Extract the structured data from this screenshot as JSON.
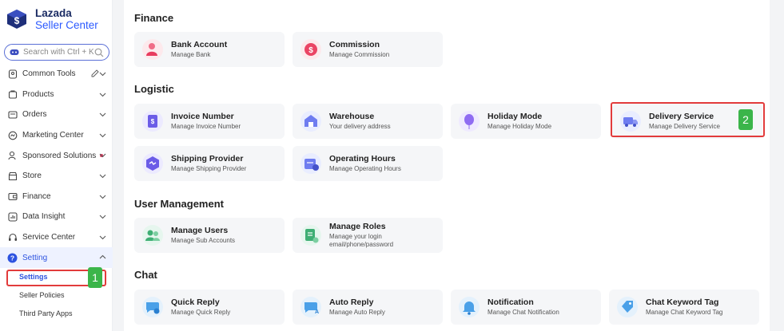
{
  "brand": {
    "line1": "Lazada",
    "line2": "Seller Center"
  },
  "search": {
    "placeholder": "Search with Ctrl + K"
  },
  "nav": [
    {
      "label": "Common Tools",
      "icon": "pin-icon"
    },
    {
      "label": "Products",
      "icon": "bag-icon"
    },
    {
      "label": "Orders",
      "icon": "orders-icon"
    },
    {
      "label": "Marketing Center",
      "icon": "marketing-icon"
    },
    {
      "label": "Sponsored Solutions",
      "icon": "sponsored-icon"
    },
    {
      "label": "Store",
      "icon": "store-icon"
    },
    {
      "label": "Finance",
      "icon": "wallet-icon"
    },
    {
      "label": "Data Insight",
      "icon": "chart-icon"
    },
    {
      "label": "Service Center",
      "icon": "headset-icon"
    },
    {
      "label": "Setting",
      "icon": "question-icon"
    }
  ],
  "setting_sub": [
    "Settings",
    "Seller Policies",
    "Third Party Apps"
  ],
  "annotations": {
    "badge1": "1",
    "badge2": "2"
  },
  "sections": [
    {
      "title": "Finance",
      "cards": [
        {
          "title": "Bank Account",
          "subtitle": "Manage Bank",
          "icon": "bank-account-icon"
        },
        {
          "title": "Commission",
          "subtitle": "Manage Commission",
          "icon": "commission-icon"
        }
      ]
    },
    {
      "title": "Logistic",
      "cards": [
        {
          "title": "Invoice Number",
          "subtitle": "Manage Invoice Number",
          "icon": "invoice-icon"
        },
        {
          "title": "Warehouse",
          "subtitle": "Your delivery address",
          "icon": "warehouse-icon"
        },
        {
          "title": "Holiday Mode",
          "subtitle": "Manage Holiday Mode",
          "icon": "balloon-icon"
        },
        {
          "title": "Delivery Service",
          "subtitle": "Manage Delivery Service",
          "icon": "truck-icon"
        },
        {
          "title": "Shipping Provider",
          "subtitle": "Manage Shipping Provider",
          "icon": "shipping-provider-icon"
        },
        {
          "title": "Operating Hours",
          "subtitle": "Manage Operating Hours",
          "icon": "calendar-icon"
        }
      ]
    },
    {
      "title": "User Management",
      "cards": [
        {
          "title": "Manage Users",
          "subtitle": "Manage Sub Accounts",
          "icon": "users-icon"
        },
        {
          "title": "Manage Roles",
          "subtitle": "Manage your login email/phone/password",
          "icon": "roles-icon"
        }
      ]
    },
    {
      "title": "Chat",
      "cards": [
        {
          "title": "Quick Reply",
          "subtitle": "Manage Quick Reply",
          "icon": "quick-reply-icon"
        },
        {
          "title": "Auto Reply",
          "subtitle": "Manage Auto Reply",
          "icon": "auto-reply-icon"
        },
        {
          "title": "Notification",
          "subtitle": "Manage Chat Notification",
          "icon": "bell-icon"
        },
        {
          "title": "Chat Keyword Tag",
          "subtitle": "Manage Chat Keyword Tag",
          "icon": "tag-icon"
        }
      ]
    }
  ],
  "colors": {
    "accent": "#2d53e0",
    "highlight": "#e23b3b",
    "badge": "#3bb54a"
  }
}
